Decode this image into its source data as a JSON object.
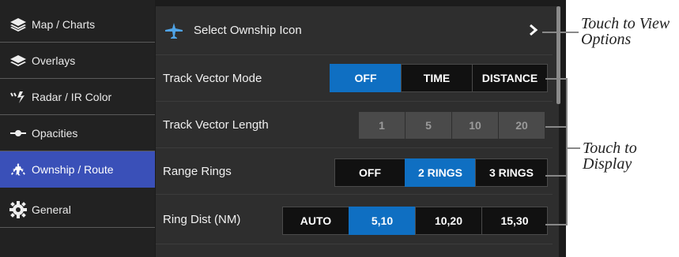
{
  "sidebar": {
    "items": [
      {
        "label": "Map / Charts",
        "icon": "layers-icon",
        "active": false
      },
      {
        "label": "Overlays",
        "icon": "overlays-icon",
        "active": false
      },
      {
        "label": "Radar / IR Color",
        "icon": "radar-icon",
        "active": false
      },
      {
        "label": "Opacities",
        "icon": "opacity-slider-icon",
        "active": false
      },
      {
        "label": "Ownship / Route",
        "icon": "ownship-icon",
        "active": true
      },
      {
        "label": "General",
        "icon": "gear-icon",
        "active": false
      }
    ]
  },
  "header": {
    "label": "Select Ownship Icon",
    "icon": "airplane-icon",
    "arrow": "chevron-right-icon"
  },
  "rows": {
    "track_vector_mode": {
      "label": "Track Vector Mode",
      "options": [
        "OFF",
        "TIME",
        "DISTANCE"
      ],
      "selected": "OFF"
    },
    "track_vector_length": {
      "label": "Track Vector Length",
      "options": [
        "1",
        "5",
        "10",
        "20"
      ],
      "selected": null,
      "disabled": true
    },
    "range_rings": {
      "label": "Range Rings",
      "options": [
        "OFF",
        "2 RINGS",
        "3 RINGS"
      ],
      "selected": "2 RINGS"
    },
    "ring_dist": {
      "label": "Ring Dist (NM)",
      "options": [
        "AUTO",
        "5,10",
        "10,20",
        "15,30"
      ],
      "selected": "5,10"
    }
  },
  "callouts": {
    "view_options": [
      "Touch to View",
      "Options"
    ],
    "display": [
      "Touch to",
      "Display"
    ]
  },
  "colors": {
    "accent": "#0f6fc2",
    "sidebar_active": "#3a50b8"
  }
}
